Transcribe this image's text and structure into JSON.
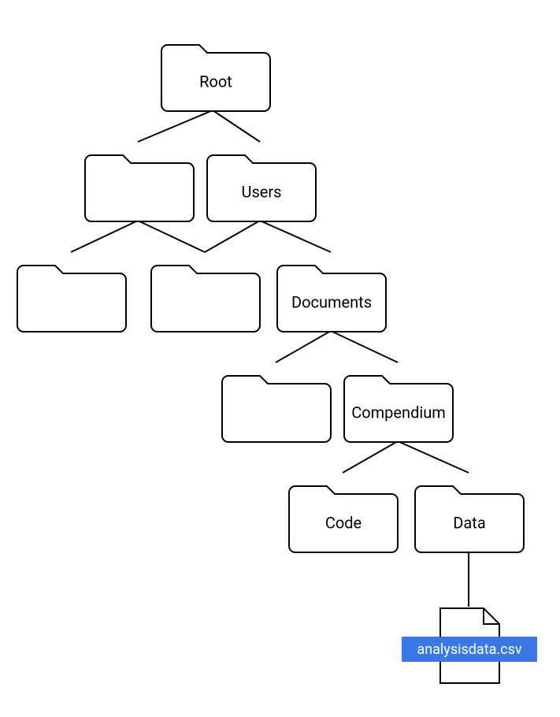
{
  "tree": {
    "root": {
      "label": "Root"
    },
    "users": {
      "label": "Users"
    },
    "documents": {
      "label": "Documents"
    },
    "compendium": {
      "label": "Compendium"
    },
    "code": {
      "label": "Code"
    },
    "data": {
      "label": "Data"
    },
    "file": {
      "label": "analysisdata.csv"
    }
  }
}
